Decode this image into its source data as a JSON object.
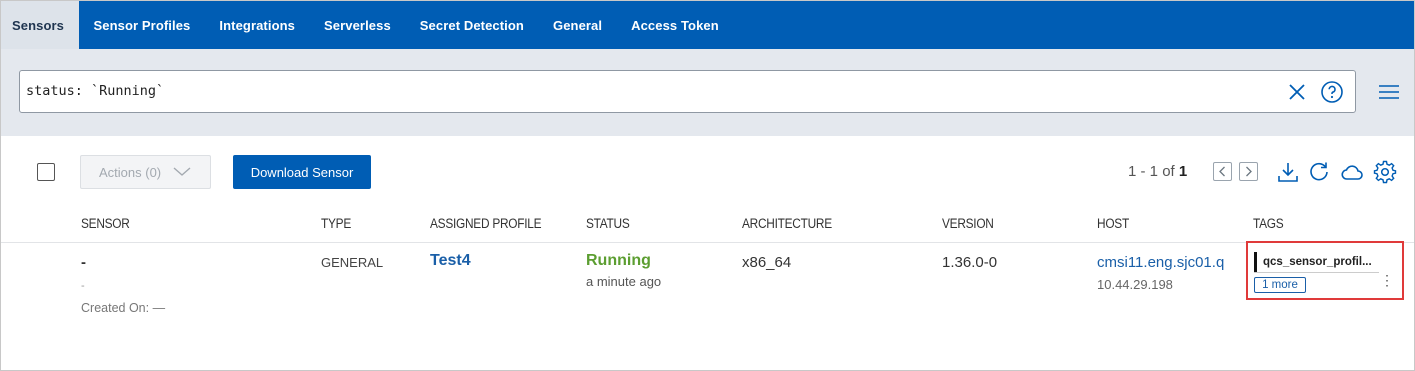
{
  "nav": {
    "tabs": [
      {
        "label": "Sensors",
        "active": true
      },
      {
        "label": "Sensor Profiles"
      },
      {
        "label": "Integrations"
      },
      {
        "label": "Serverless"
      },
      {
        "label": "Secret Detection"
      },
      {
        "label": "General"
      },
      {
        "label": "Access Token"
      }
    ]
  },
  "search": {
    "value": "status: `Running`",
    "clear_icon": "close-icon",
    "help_icon": "help-circle-icon"
  },
  "toolbar": {
    "actions_label": "Actions (0)",
    "download_label": "Download Sensor",
    "pager": {
      "range": "1 - 1",
      "of": "of",
      "total": "1"
    }
  },
  "table": {
    "headers": [
      "SENSOR",
      "TYPE",
      "ASSIGNED PROFILE",
      "STATUS",
      "ARCHITECTURE",
      "VERSION",
      "HOST",
      "TAGS"
    ],
    "rows": [
      {
        "sensor": "-",
        "sensor_sub": "-",
        "created_on": "Created On: —",
        "type": "GENERAL",
        "profile": "Test4",
        "status": "Running",
        "status_time": "a minute ago",
        "architecture": "x86_64",
        "version": "1.36.0-0",
        "host": "cmsi11.eng.sjc01.q",
        "host_ip": "10.44.29.198",
        "tag": "qcs_sensor_profil...",
        "more": "1 more"
      }
    ]
  },
  "colors": {
    "brand": "#005db4",
    "running": "#5c9e31",
    "link": "#1a5fa8",
    "highlight": "#e03a3a"
  }
}
